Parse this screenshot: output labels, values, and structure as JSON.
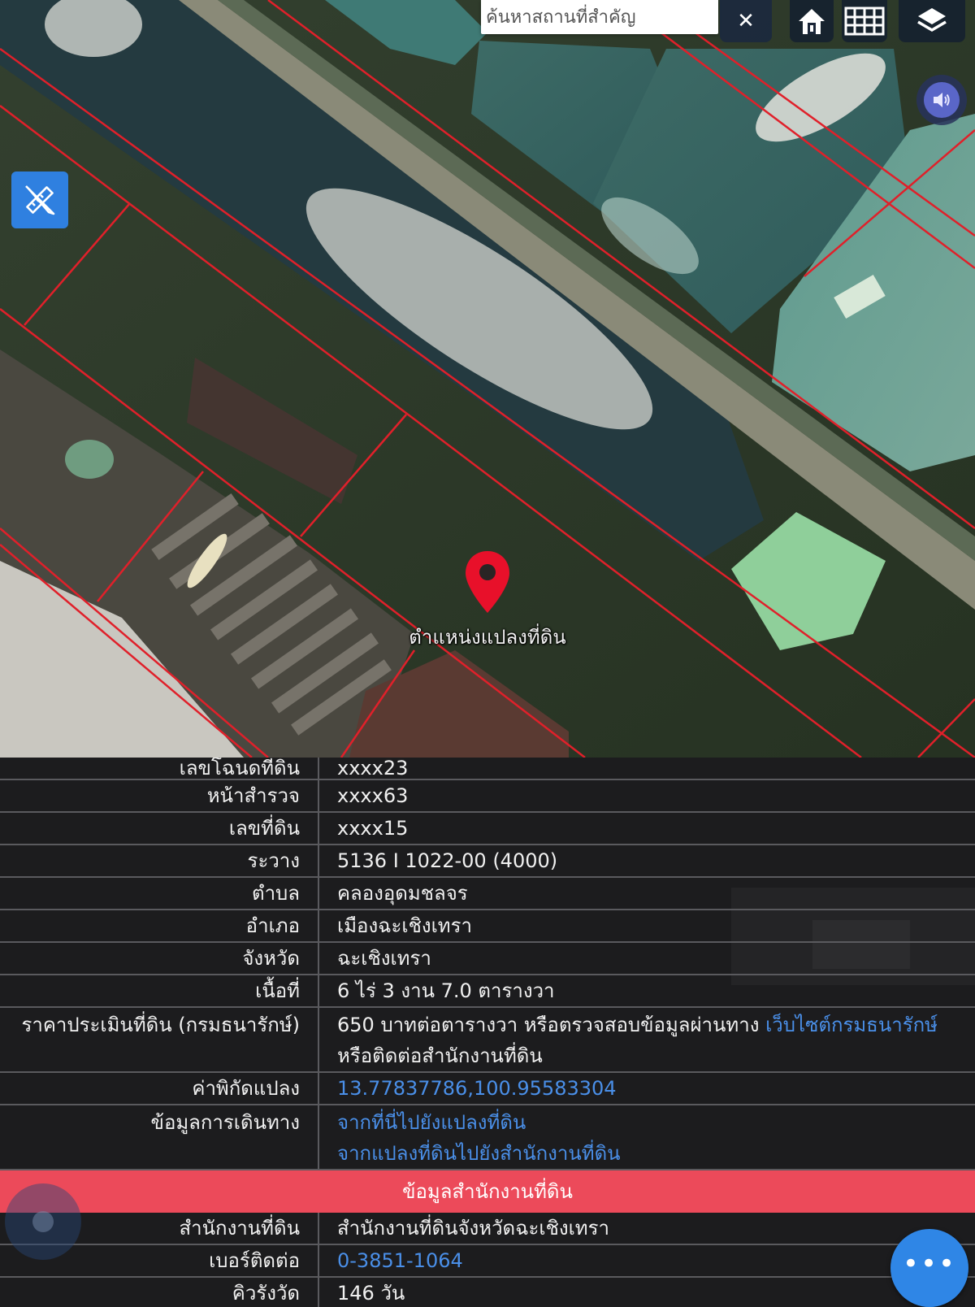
{
  "map": {
    "search": {
      "placeholder": "ค้นหาสถานที่สำคัญ",
      "value": ""
    },
    "clear_label": "✕",
    "marker_label": "ตำแหน่งแปลงที่ดิน"
  },
  "rows": [
    {
      "label": "เลขโฉนดที่ดิน",
      "value": "xxxx23"
    },
    {
      "label": "หน้าสำรวจ",
      "value": "xxxx63"
    },
    {
      "label": "เลขที่ดิน",
      "value": "xxxx15"
    },
    {
      "label": "ระวาง",
      "value": "5136 I 1022-00 (4000)"
    },
    {
      "label": "ตำบล",
      "value": "คลองอุดมชลจร"
    },
    {
      "label": "อำเภอ",
      "value": "เมืองฉะเชิงเทรา"
    },
    {
      "label": "จังหวัด",
      "value": "ฉะเชิงเทรา"
    },
    {
      "label": "เนื้อที่",
      "value": "6 ไร่ 3 งาน 7.0 ตารางวา"
    }
  ],
  "price": {
    "label": "ราคาประเมินที่ดิน (กรมธนารักษ์)",
    "value_prefix": "650 บาทต่อตารางวา หรือตรวจสอบข้อมูลผ่านทาง ",
    "link": "เว็บไซต์กรมธนารักษ์",
    "value_line2": "หรือติดต่อสำนักงานที่ดิน"
  },
  "coords": {
    "label": "ค่าพิกัดแปลง",
    "value": "13.77837786,100.95583304"
  },
  "travel": {
    "label": "ข้อมูลการเดินทาง",
    "link1": "จากที่นี่ไปยังแปลงที่ดิน",
    "link2": "จากแปลงที่ดินไปยังสำนักงานที่ดิน"
  },
  "office_section": {
    "title": "ข้อมูลสำนักงานที่ดิน",
    "office_label": "สำนักงานที่ดิน",
    "office_value": "สำนักงานที่ดินจังหวัดฉะเชิงเทรา",
    "phone_label": "เบอร์ติดต่อ",
    "phone_value": "0-3851-1064",
    "queue_label": "คิวรังวัด",
    "queue_value": "146 วัน"
  },
  "fab_label": "•••",
  "colors": {
    "accent_blue": "#2f86e6",
    "link_blue": "#4a8fe8",
    "section_red": "#ec4a5a",
    "parcel_line": "#e0202a",
    "marker_red": "#e8102a"
  }
}
